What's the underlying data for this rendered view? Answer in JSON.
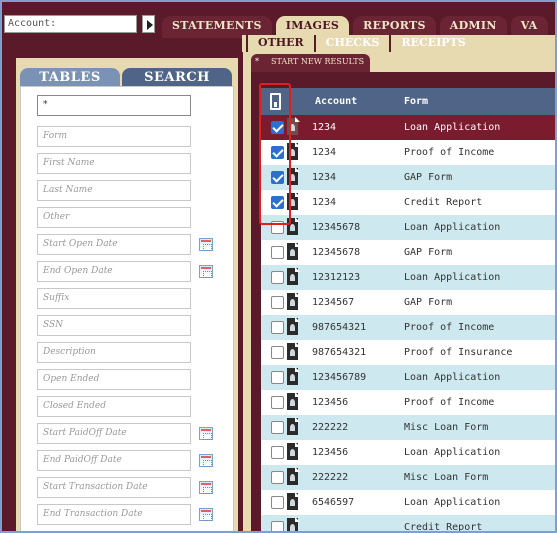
{
  "colors": {
    "maroon": "#5b1a2a",
    "tan": "#e8dab0",
    "header_blue": "#4f6487",
    "row_alt": "#cde8ee",
    "selected_row": "#7a1c2e",
    "checkbox_blue": "#2d6fcf",
    "highlight_red": "#e0201c"
  },
  "account": {
    "label": "Account:"
  },
  "main_nav": [
    "STATEMENTS",
    "IMAGES",
    "REPORTS",
    "ADMIN",
    "VA"
  ],
  "sub_nav": [
    "OTHER",
    "CHECKS",
    "RECEIPTS"
  ],
  "left_tabs": {
    "tables": "TABLES",
    "search": "SEARCH"
  },
  "search_fields": [
    {
      "placeholder": "*"
    },
    {
      "placeholder": "Form"
    },
    {
      "placeholder": "First Name"
    },
    {
      "placeholder": "Last Name"
    },
    {
      "placeholder": "Other"
    },
    {
      "placeholder": "Start Open Date"
    },
    {
      "placeholder": "End Open Date"
    },
    {
      "placeholder": "Suffix"
    },
    {
      "placeholder": "SSN"
    },
    {
      "placeholder": "Description"
    },
    {
      "placeholder": "Open Ended"
    },
    {
      "placeholder": "Closed Ended"
    },
    {
      "placeholder": "Start PaidOff Date"
    },
    {
      "placeholder": "End PaidOff Date"
    },
    {
      "placeholder": "Start Transaction Date"
    },
    {
      "placeholder": "End Transaction Date"
    }
  ],
  "result_tab": {
    "indicator": "*",
    "label": "START NEW RESULTS"
  },
  "table": {
    "columns": [
      "Account",
      "Form"
    ],
    "rows": [
      {
        "account": "1234",
        "form": "Loan Application",
        "checked": true
      },
      {
        "account": "1234",
        "form": "Proof of Income",
        "checked": true
      },
      {
        "account": "1234",
        "form": "GAP Form",
        "checked": true
      },
      {
        "account": "1234",
        "form": "Credit Report",
        "checked": true
      },
      {
        "account": "12345678",
        "form": "Loan Application",
        "checked": false
      },
      {
        "account": "12345678",
        "form": "GAP Form",
        "checked": false
      },
      {
        "account": "12312123",
        "form": "Loan Application",
        "checked": false
      },
      {
        "account": "1234567",
        "form": "GAP Form",
        "checked": false
      },
      {
        "account": "987654321",
        "form": "Proof of Income",
        "checked": false
      },
      {
        "account": "987654321",
        "form": "Proof of Insurance",
        "checked": false
      },
      {
        "account": "123456789",
        "form": "Loan Application",
        "checked": false
      },
      {
        "account": "123456",
        "form": "Proof of Income",
        "checked": false
      },
      {
        "account": "222222",
        "form": "Misc Loan Form",
        "checked": false
      },
      {
        "account": "123456",
        "form": "Loan Application",
        "checked": false
      },
      {
        "account": "222222",
        "form": "Misc Loan Form",
        "checked": false
      },
      {
        "account": "6546597",
        "form": "Loan Application",
        "checked": false
      },
      {
        "account": "",
        "form": "Credit Report",
        "checked": false
      }
    ]
  }
}
